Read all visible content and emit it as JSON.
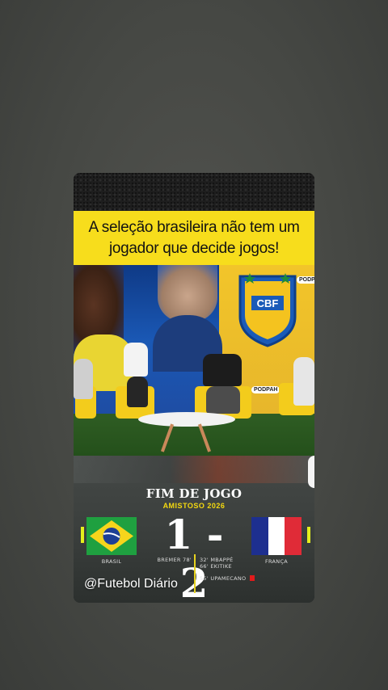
{
  "post": {
    "headline": "A seleção brasileira não tem um jogador que decide jogos!",
    "podcast_logo_1": "PODPAH",
    "podcast_logo_2": "PODPAH",
    "crest_text": "CBF"
  },
  "scoreboard": {
    "title": "FIM DE JOGO",
    "subtitle": "AMISTOSO 2026",
    "score": "1 - 2",
    "home_team": "BRASIL",
    "away_team": "FRANÇA",
    "home_scorer": "BREMER 78'",
    "away_scorers": [
      "32' MBAPPÉ",
      "66' EKITIKE"
    ],
    "away_red_card": "55' UPAMECANO",
    "watermark": "@Futebol Diário"
  },
  "colors": {
    "headline_bg": "#f7dd1c",
    "accent_yellow": "#f5d90f",
    "flag_br_green": "#1fa040",
    "flag_br_yellow": "#f6d51c",
    "flag_br_blue": "#1e3f95",
    "flag_fr_blue": "#1d2f8f",
    "flag_fr_white": "#ffffff",
    "flag_fr_red": "#e02b37",
    "red_card": "#e21b1b"
  }
}
